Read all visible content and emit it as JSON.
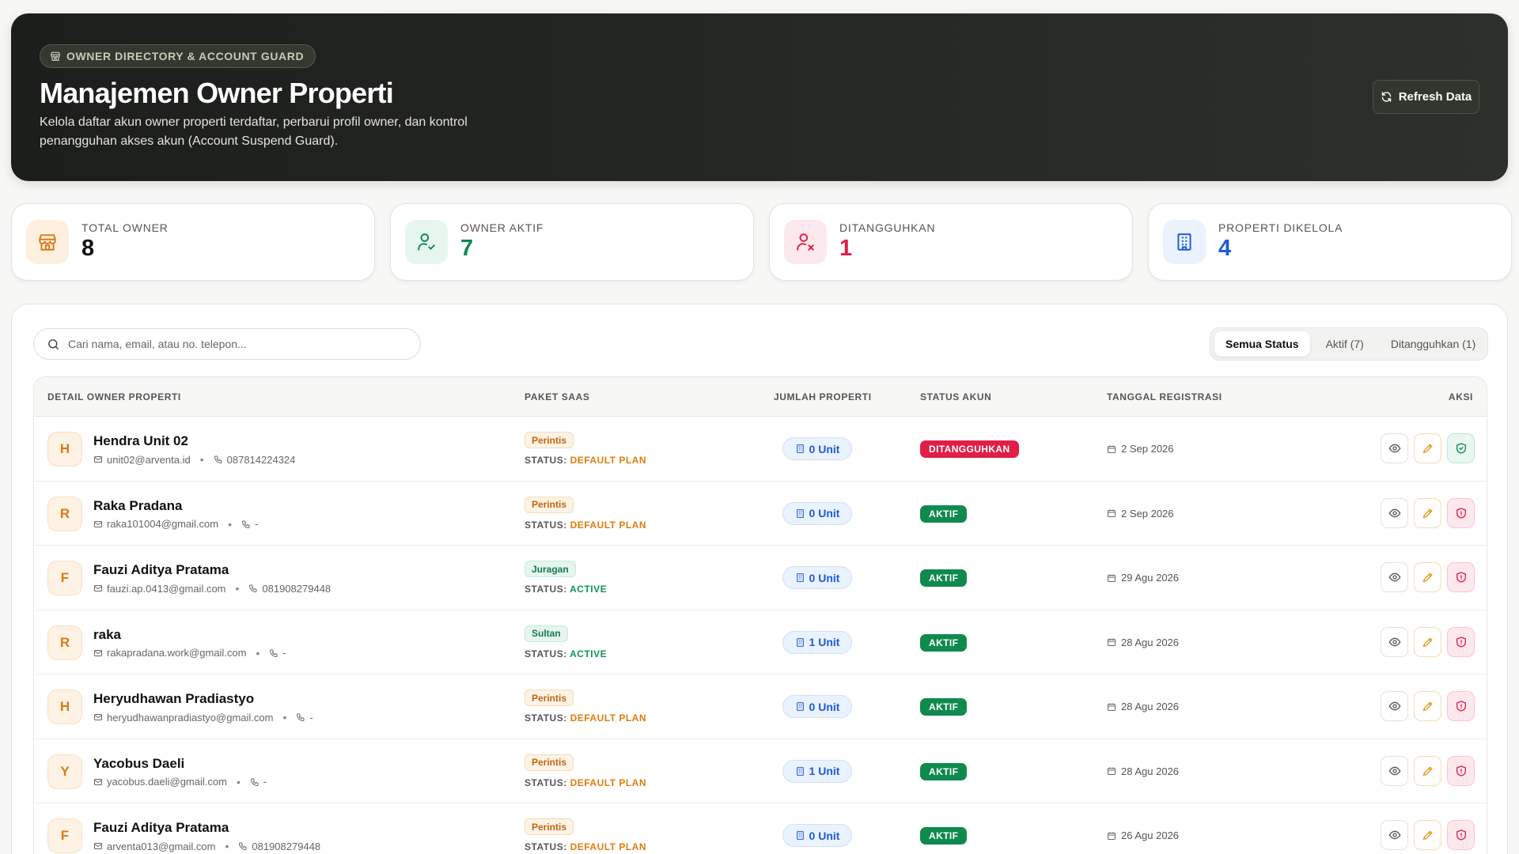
{
  "header": {
    "badge": "OWNER DIRECTORY & ACCOUNT GUARD",
    "title": "Manajemen Owner Properti",
    "description": "Kelola daftar akun owner properti terdaftar, perbarui profil owner, dan kontrol penangguhan akses akun (Account Suspend Guard).",
    "refresh_label": "Refresh Data"
  },
  "stats": [
    {
      "label": "TOTAL OWNER",
      "value": "8",
      "icon": "store-icon",
      "color": "#111111"
    },
    {
      "label": "OWNER AKTIF",
      "value": "7",
      "icon": "user-check-icon",
      "color": "#0f8a4f"
    },
    {
      "label": "DITANGGUHKAN",
      "value": "1",
      "icon": "user-x-icon",
      "color": "#e11d48"
    },
    {
      "label": "PROPERTI DIKELOLA",
      "value": "4",
      "icon": "building-icon",
      "color": "#1e5bd6"
    }
  ],
  "search": {
    "placeholder": "Cari nama, email, atau no. telepon..."
  },
  "filters": [
    {
      "label": "Semua Status",
      "active": true
    },
    {
      "label": "Aktif (7)",
      "active": false
    },
    {
      "label": "Ditangguhkan (1)",
      "active": false
    }
  ],
  "table": {
    "columns": [
      "DETAIL OWNER PROPERTI",
      "PAKET SAAS",
      "JUMLAH PROPERTI",
      "STATUS AKUN",
      "TANGGAL REGISTRASI",
      "AKSI"
    ],
    "status_prefix": "STATUS:",
    "rows": [
      {
        "initial": "H",
        "name": "Hendra Unit 02",
        "email": "unit02@arventa.id",
        "phone": "087814224324",
        "plan": "Perintis",
        "plan_status": "DEFAULT PLAN",
        "units": "0 Unit",
        "status": "DITANGGUHKAN",
        "date": "2 Sep 2026"
      },
      {
        "initial": "R",
        "name": "Raka Pradana",
        "email": "raka101004@gmail.com",
        "phone": "-",
        "plan": "Perintis",
        "plan_status": "DEFAULT PLAN",
        "units": "0 Unit",
        "status": "AKTIF",
        "date": "2 Sep 2026"
      },
      {
        "initial": "F",
        "name": "Fauzi Aditya Pratama",
        "email": "fauzi.ap.0413@gmail.com",
        "phone": "081908279448",
        "plan": "Juragan",
        "plan_status": "ACTIVE",
        "units": "0 Unit",
        "status": "AKTIF",
        "date": "29 Agu 2026"
      },
      {
        "initial": "R",
        "name": "raka",
        "email": "rakapradana.work@gmail.com",
        "phone": "-",
        "plan": "Sultan",
        "plan_status": "ACTIVE",
        "units": "1 Unit",
        "status": "AKTIF",
        "date": "28 Agu 2026"
      },
      {
        "initial": "H",
        "name": "Heryudhawan Pradiastyo",
        "email": "heryudhawanpradiastyo@gmail.com",
        "phone": "-",
        "plan": "Perintis",
        "plan_status": "DEFAULT PLAN",
        "units": "0 Unit",
        "status": "AKTIF",
        "date": "28 Agu 2026"
      },
      {
        "initial": "Y",
        "name": "Yacobus Daeli",
        "email": "yacobus.daeli@gmail.com",
        "phone": "-",
        "plan": "Perintis",
        "plan_status": "DEFAULT PLAN",
        "units": "1 Unit",
        "status": "AKTIF",
        "date": "28 Agu 2026"
      },
      {
        "initial": "F",
        "name": "Fauzi Aditya Pratama",
        "email": "arventa013@gmail.com",
        "phone": "081908279448",
        "plan": "Perintis",
        "plan_status": "DEFAULT PLAN",
        "units": "0 Unit",
        "status": "AKTIF",
        "date": "26 Agu 2026"
      }
    ]
  }
}
